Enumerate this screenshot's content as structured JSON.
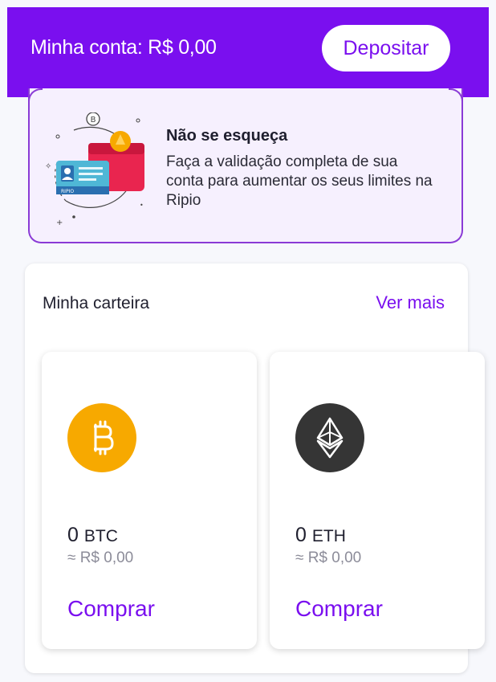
{
  "header": {
    "account_label": "Minha conta: R$ 0,00",
    "deposit_label": "Depositar"
  },
  "banner": {
    "title": "Não se esqueça",
    "text": "Faça a validação completa de sua conta para aumentar os seus limites na Ripio",
    "illustration_icon": "id-card-wallet-icon",
    "card_caption": "RIPIO"
  },
  "wallet": {
    "title": "Minha carteira",
    "more_label": "Ver mais",
    "coins": [
      {
        "icon": "bitcoin-icon",
        "color": "#f7a900",
        "amount": "0",
        "unit": "BTC",
        "fiat": "≈ R$ 0,00",
        "buy_label": "Comprar"
      },
      {
        "icon": "ethereum-icon",
        "color": "#353535",
        "amount": "0",
        "unit": "ETH",
        "fiat": "≈ R$ 0,00",
        "buy_label": "Comprar"
      }
    ]
  },
  "colors": {
    "brand": "#7a0fef",
    "banner_bg": "#f6f0fe",
    "banner_border": "#8a3bd6"
  }
}
